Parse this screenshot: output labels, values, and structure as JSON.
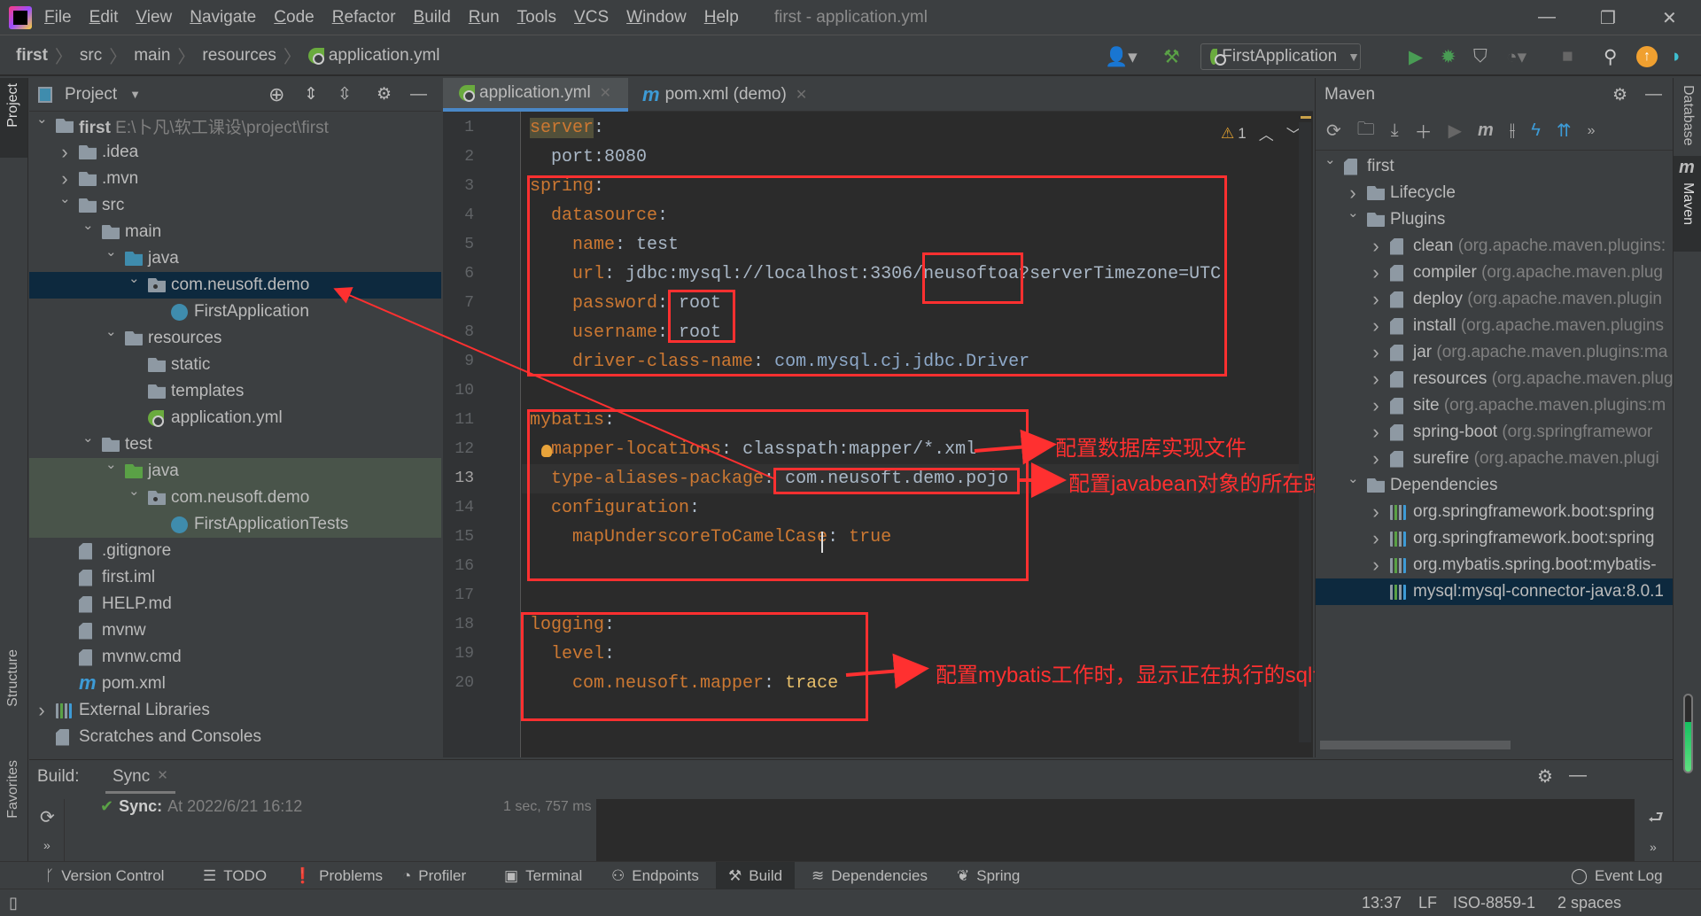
{
  "menu": {
    "items": [
      "File",
      "Edit",
      "View",
      "Navigate",
      "Code",
      "Refactor",
      "Build",
      "Run",
      "Tools",
      "VCS",
      "Window",
      "Help"
    ],
    "window_title": "first - application.yml"
  },
  "breadcrumb": [
    "first",
    "src",
    "main",
    "resources",
    "application.yml"
  ],
  "toolbar": {
    "run_config": "FirstApplication"
  },
  "left_stripe": {
    "project": "Project",
    "structure": "Structure",
    "favorites": "Favorites"
  },
  "right_stripe": {
    "database": "Database",
    "maven": "Maven"
  },
  "project": {
    "title": "Project",
    "tree": [
      {
        "label": "first",
        "secondary": "E:\\卜凡\\软工课设\\project\\first",
        "level": 0,
        "arrow": "down",
        "icon": "module-folder",
        "bold": true
      },
      {
        "label": ".idea",
        "level": 1,
        "arrow": "right",
        "icon": "folder"
      },
      {
        "label": ".mvn",
        "level": 1,
        "arrow": "right",
        "icon": "folder"
      },
      {
        "label": "src",
        "level": 1,
        "arrow": "down",
        "icon": "folder"
      },
      {
        "label": "main",
        "level": 2,
        "arrow": "down",
        "icon": "folder"
      },
      {
        "label": "java",
        "level": 3,
        "arrow": "down",
        "icon": "source-folder"
      },
      {
        "label": "com.neusoft.demo",
        "level": 4,
        "arrow": "down",
        "icon": "package",
        "selected": true
      },
      {
        "label": "FirstApplication",
        "level": 5,
        "icon": "spring-boot-class"
      },
      {
        "label": "resources",
        "level": 3,
        "arrow": "down",
        "icon": "resources-folder"
      },
      {
        "label": "static",
        "level": 4,
        "icon": "folder"
      },
      {
        "label": "templates",
        "level": 4,
        "icon": "folder"
      },
      {
        "label": "application.yml",
        "level": 4,
        "icon": "spring-yml"
      },
      {
        "label": "test",
        "level": 2,
        "arrow": "down",
        "icon": "folder"
      },
      {
        "label": "java",
        "level": 3,
        "arrow": "down",
        "icon": "test-folder",
        "test": true
      },
      {
        "label": "com.neusoft.demo",
        "level": 4,
        "arrow": "down",
        "icon": "package",
        "test": true
      },
      {
        "label": "FirstApplicationTests",
        "level": 5,
        "icon": "test-class",
        "test": true
      },
      {
        "label": ".gitignore",
        "level": 1,
        "icon": "file"
      },
      {
        "label": "first.iml",
        "level": 1,
        "icon": "file"
      },
      {
        "label": "HELP.md",
        "level": 1,
        "icon": "markdown-file"
      },
      {
        "label": "mvnw",
        "level": 1,
        "icon": "shell-file"
      },
      {
        "label": "mvnw.cmd",
        "level": 1,
        "icon": "file"
      },
      {
        "label": "pom.xml",
        "level": 1,
        "icon": "maven-file"
      },
      {
        "label": "External Libraries",
        "level": 0,
        "arrow": "right",
        "icon": "library"
      },
      {
        "label": "Scratches and Consoles",
        "level": 0,
        "icon": "scratches"
      }
    ]
  },
  "editor": {
    "tabs": [
      {
        "label": "application.yml",
        "active": true
      },
      {
        "label": "pom.xml (demo)",
        "active": false
      }
    ],
    "warning_count": "1",
    "current_line": 13,
    "lines": [
      [
        [
          "server",
          "k srv"
        ],
        [
          ":",
          "p"
        ]
      ],
      [
        [
          "  port:8080",
          "v"
        ]
      ],
      [
        [
          "spring",
          "k"
        ],
        [
          ":",
          "p"
        ]
      ],
      [
        [
          "  datasource",
          "k"
        ],
        [
          ":",
          "p"
        ]
      ],
      [
        [
          "    name",
          "k"
        ],
        [
          ": ",
          "p"
        ],
        [
          "test",
          "v"
        ]
      ],
      [
        [
          "    url",
          "k"
        ],
        [
          ": ",
          "p"
        ],
        [
          "jdbc:mysql://localhost:3306/neusoftoa?serverTimezone=UTC",
          "v"
        ]
      ],
      [
        [
          "    password",
          "k"
        ],
        [
          ": ",
          "p"
        ],
        [
          "root",
          "v"
        ]
      ],
      [
        [
          "    username",
          "k"
        ],
        [
          ": ",
          "p"
        ],
        [
          "root",
          "v"
        ]
      ],
      [
        [
          "    driver-class-name",
          "k"
        ],
        [
          ": ",
          "p"
        ],
        [
          "com.mysql.cj.jdbc.Driver",
          "c"
        ]
      ],
      [],
      [
        [
          "mybatis",
          "k"
        ],
        [
          ":",
          "p"
        ]
      ],
      [
        [
          "  mapper-locations",
          "k"
        ],
        [
          ": ",
          "p"
        ],
        [
          "classpath:mapper/*.xml",
          "v"
        ]
      ],
      [
        [
          "  type-aliases-package",
          "k"
        ],
        [
          ": ",
          "p"
        ],
        [
          "com.neusoft.demo.pojo",
          "v"
        ]
      ],
      [
        [
          "  configuration",
          "k"
        ],
        [
          ":",
          "p"
        ]
      ],
      [
        [
          "    mapUnderscoreToCamelCase",
          "k"
        ],
        [
          ": ",
          "p"
        ],
        [
          "true",
          "b"
        ]
      ],
      [],
      [],
      [
        [
          "logging",
          "k"
        ],
        [
          ":",
          "p"
        ]
      ],
      [
        [
          "  level",
          "k"
        ],
        [
          ":",
          "p"
        ]
      ],
      [
        [
          "    com.neusoft.mapper",
          "k"
        ],
        [
          ": ",
          "p"
        ],
        [
          "trace",
          "y"
        ]
      ]
    ]
  },
  "annotations": {
    "mapper": "配置数据库实现文件",
    "aliases": "配置javabean对象的所在路径",
    "logging": "配置mybatis工作时，显示正在执行的sql语句"
  },
  "maven": {
    "title": "Maven",
    "tree": [
      {
        "label": "first",
        "level": 0,
        "arrow": "down",
        "icon": "maven-module"
      },
      {
        "label": "Lifecycle",
        "level": 1,
        "arrow": "right",
        "icon": "config-folder"
      },
      {
        "label": "Plugins",
        "level": 1,
        "arrow": "down",
        "icon": "config-folder"
      },
      {
        "label": "clean",
        "secondary": "(org.apache.maven.plugins:",
        "level": 2,
        "arrow": "right",
        "icon": "plugin"
      },
      {
        "label": "compiler",
        "secondary": "(org.apache.maven.plug",
        "level": 2,
        "arrow": "right",
        "icon": "plugin"
      },
      {
        "label": "deploy",
        "secondary": "(org.apache.maven.plugin",
        "level": 2,
        "arrow": "right",
        "icon": "plugin"
      },
      {
        "label": "install",
        "secondary": "(org.apache.maven.plugins",
        "level": 2,
        "arrow": "right",
        "icon": "plugin"
      },
      {
        "label": "jar",
        "secondary": "(org.apache.maven.plugins:ma",
        "level": 2,
        "arrow": "right",
        "icon": "plugin"
      },
      {
        "label": "resources",
        "secondary": "(org.apache.maven.plug",
        "level": 2,
        "arrow": "right",
        "icon": "plugin"
      },
      {
        "label": "site",
        "secondary": "(org.apache.maven.plugins:m",
        "level": 2,
        "arrow": "right",
        "icon": "plugin"
      },
      {
        "label": "spring-boot",
        "secondary": "(org.springframewor",
        "level": 2,
        "arrow": "right",
        "icon": "plugin"
      },
      {
        "label": "surefire",
        "secondary": "(org.apache.maven.plugi",
        "level": 2,
        "arrow": "right",
        "icon": "plugin"
      },
      {
        "label": "Dependencies",
        "level": 1,
        "arrow": "down",
        "icon": "dependencies-folder"
      },
      {
        "label": "org.springframework.boot:spring",
        "level": 2,
        "arrow": "right",
        "icon": "library"
      },
      {
        "label": "org.springframework.boot:spring",
        "level": 2,
        "arrow": "right",
        "icon": "library"
      },
      {
        "label": "org.mybatis.spring.boot:mybatis-",
        "level": 2,
        "arrow": "right",
        "icon": "library"
      },
      {
        "label": "mysql:mysql-connector-java:8.0.1",
        "level": 2,
        "icon": "library",
        "selected": true
      }
    ]
  },
  "build": {
    "label": "Build:",
    "tab": "Sync",
    "sync_label": "Sync:",
    "sync_time": "At 2022/6/21 16:12",
    "duration": "1 sec, 757 ms"
  },
  "bottom_tabs": [
    "Version Control",
    "TODO",
    "Problems",
    "Profiler",
    "Terminal",
    "Endpoints",
    "Build",
    "Dependencies",
    "Spring"
  ],
  "active_bottom_tab": "Build",
  "event_log": "Event Log",
  "status": {
    "position": "13:37",
    "line_sep": "LF",
    "encoding": "ISO-8859-1",
    "indent": "2 spaces"
  },
  "colors": {
    "accent": "#4a88c7",
    "annotation": "#ff3030",
    "selection": "#0d293e",
    "key": "#cc7832"
  }
}
